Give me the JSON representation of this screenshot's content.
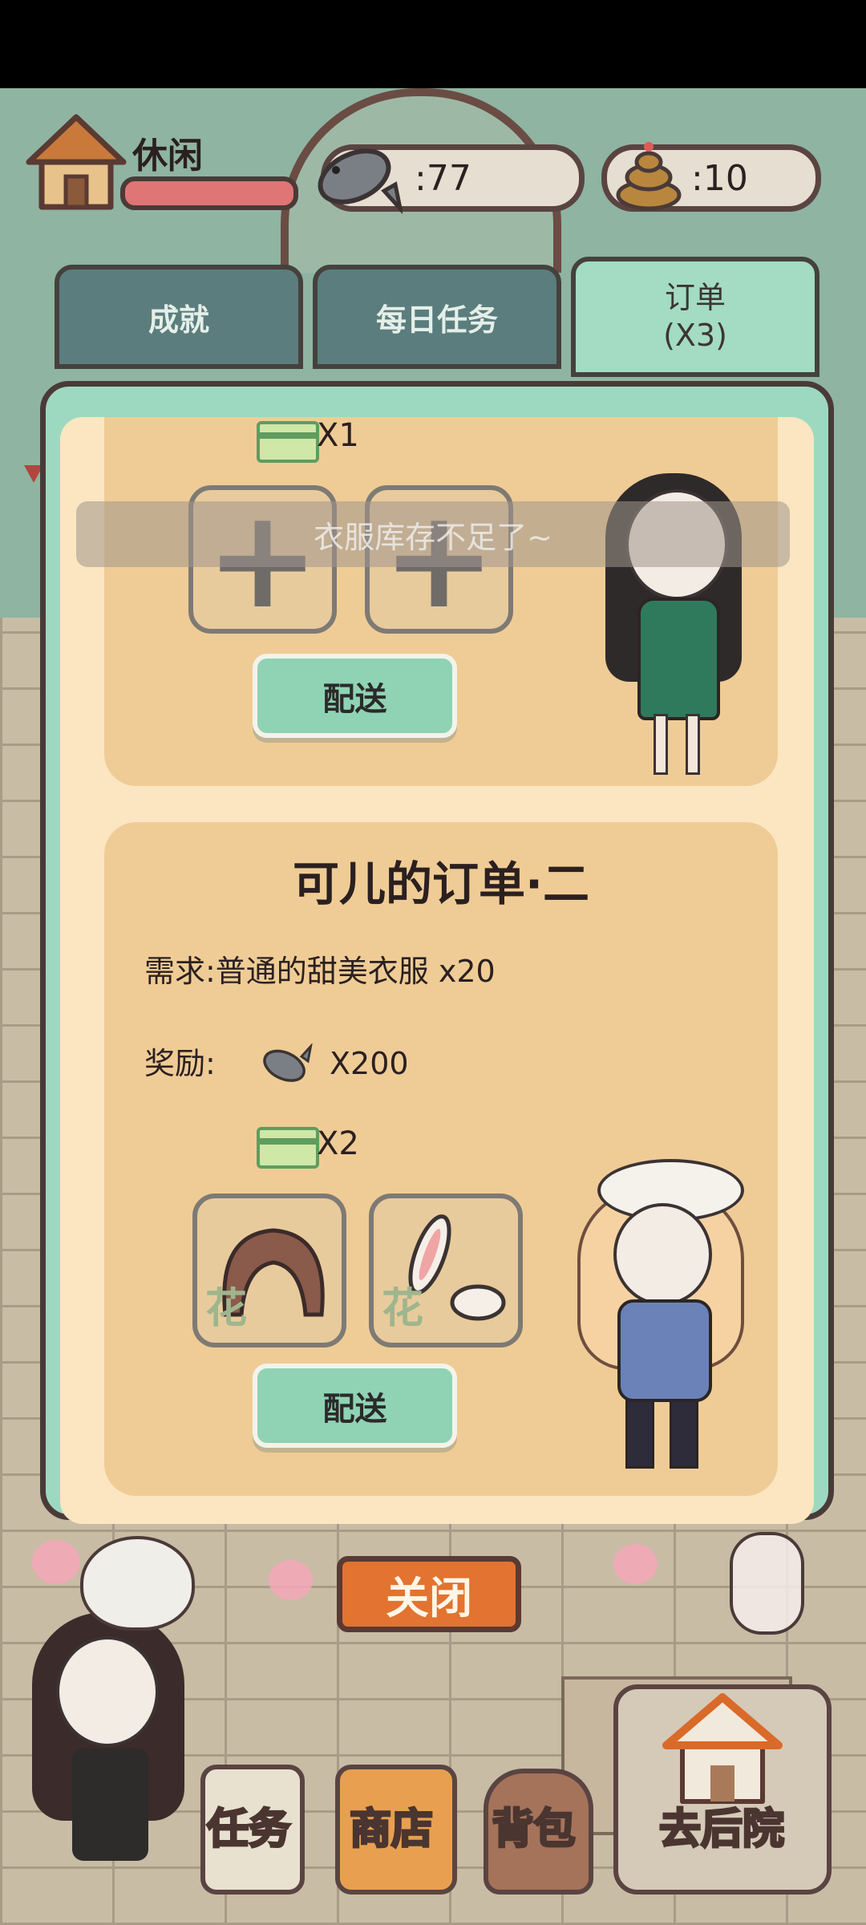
{
  "header": {
    "status_label": "休闲",
    "fish_value": ":77",
    "poop_value": ":10"
  },
  "tabs": [
    {
      "label": "成就"
    },
    {
      "label": "每日任务"
    },
    {
      "label": "订单",
      "sub": "(X3)"
    }
  ],
  "toast": "衣服库存不足了~",
  "order1": {
    "ticket_qty": "X1",
    "deliver_label": "配送"
  },
  "order2": {
    "title": "可儿的订单·二",
    "requirement": "需求:普通的甜美衣服 x20",
    "reward_label": "奖励:",
    "reward_qty": "X200",
    "ticket_qty": "X2",
    "slot_tag": "花",
    "deliver_label": "配送"
  },
  "close_label": "关闭",
  "bottom_nav": {
    "tasks": "任务",
    "shop": "商店",
    "bag": "背包",
    "backyard": "去后院"
  },
  "colors": {
    "panel": "#9dd9c0",
    "card": "#efcc96",
    "button": "#8fd3b4",
    "close": "#e27330"
  }
}
